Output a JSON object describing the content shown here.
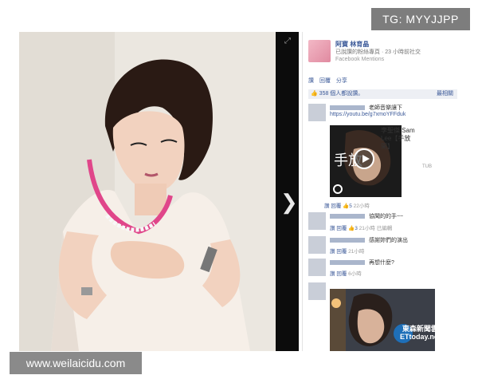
{
  "watermarks": {
    "top": "TG: MYYJJPP",
    "bottom": "www.weilaicidu.com"
  },
  "viewer": {
    "next_glyph": "❯",
    "expand_glyph": "⤢"
  },
  "post": {
    "page_name": "阿寶 林育晶",
    "subtitle": "已說讚的粉絲專頁 · 23 小時前社交",
    "via": "Facebook Mentions",
    "actions": [
      "讚",
      "回覆",
      "分享"
    ],
    "likes": "358 個人都說讚。",
    "sort": "最相關"
  },
  "comments": [
    {
      "text": "老師音樂讓下",
      "link": "https://youtu.be/g7xmoYFFduk",
      "meta": [
        "讚",
        "回覆"
      ],
      "like_count": "5",
      "time": "22小時"
    },
    {
      "text": "協聞的的手~~",
      "meta": [
        "讚",
        "回覆"
      ],
      "like_count": "3",
      "time": "21小時",
      "extra": "已編輯"
    },
    {
      "text": "感謝妳們的演出",
      "meta": [
        "讚",
        "回覆"
      ],
      "time": "21小時"
    },
    {
      "text": "再想什麼?",
      "meta": [
        "讚",
        "回覆"
      ],
      "time": "6小時"
    }
  ],
  "video": {
    "title": "李聖傑 Sam Lee【手放開】",
    "source": "TUB",
    "overlay_text": "手放"
  },
  "news": {
    "logo_line1": "東森新聞雲",
    "logo_line2": "ETtoday.net"
  },
  "icons": {
    "like": "like-thumb-icon",
    "play": "play-icon"
  }
}
